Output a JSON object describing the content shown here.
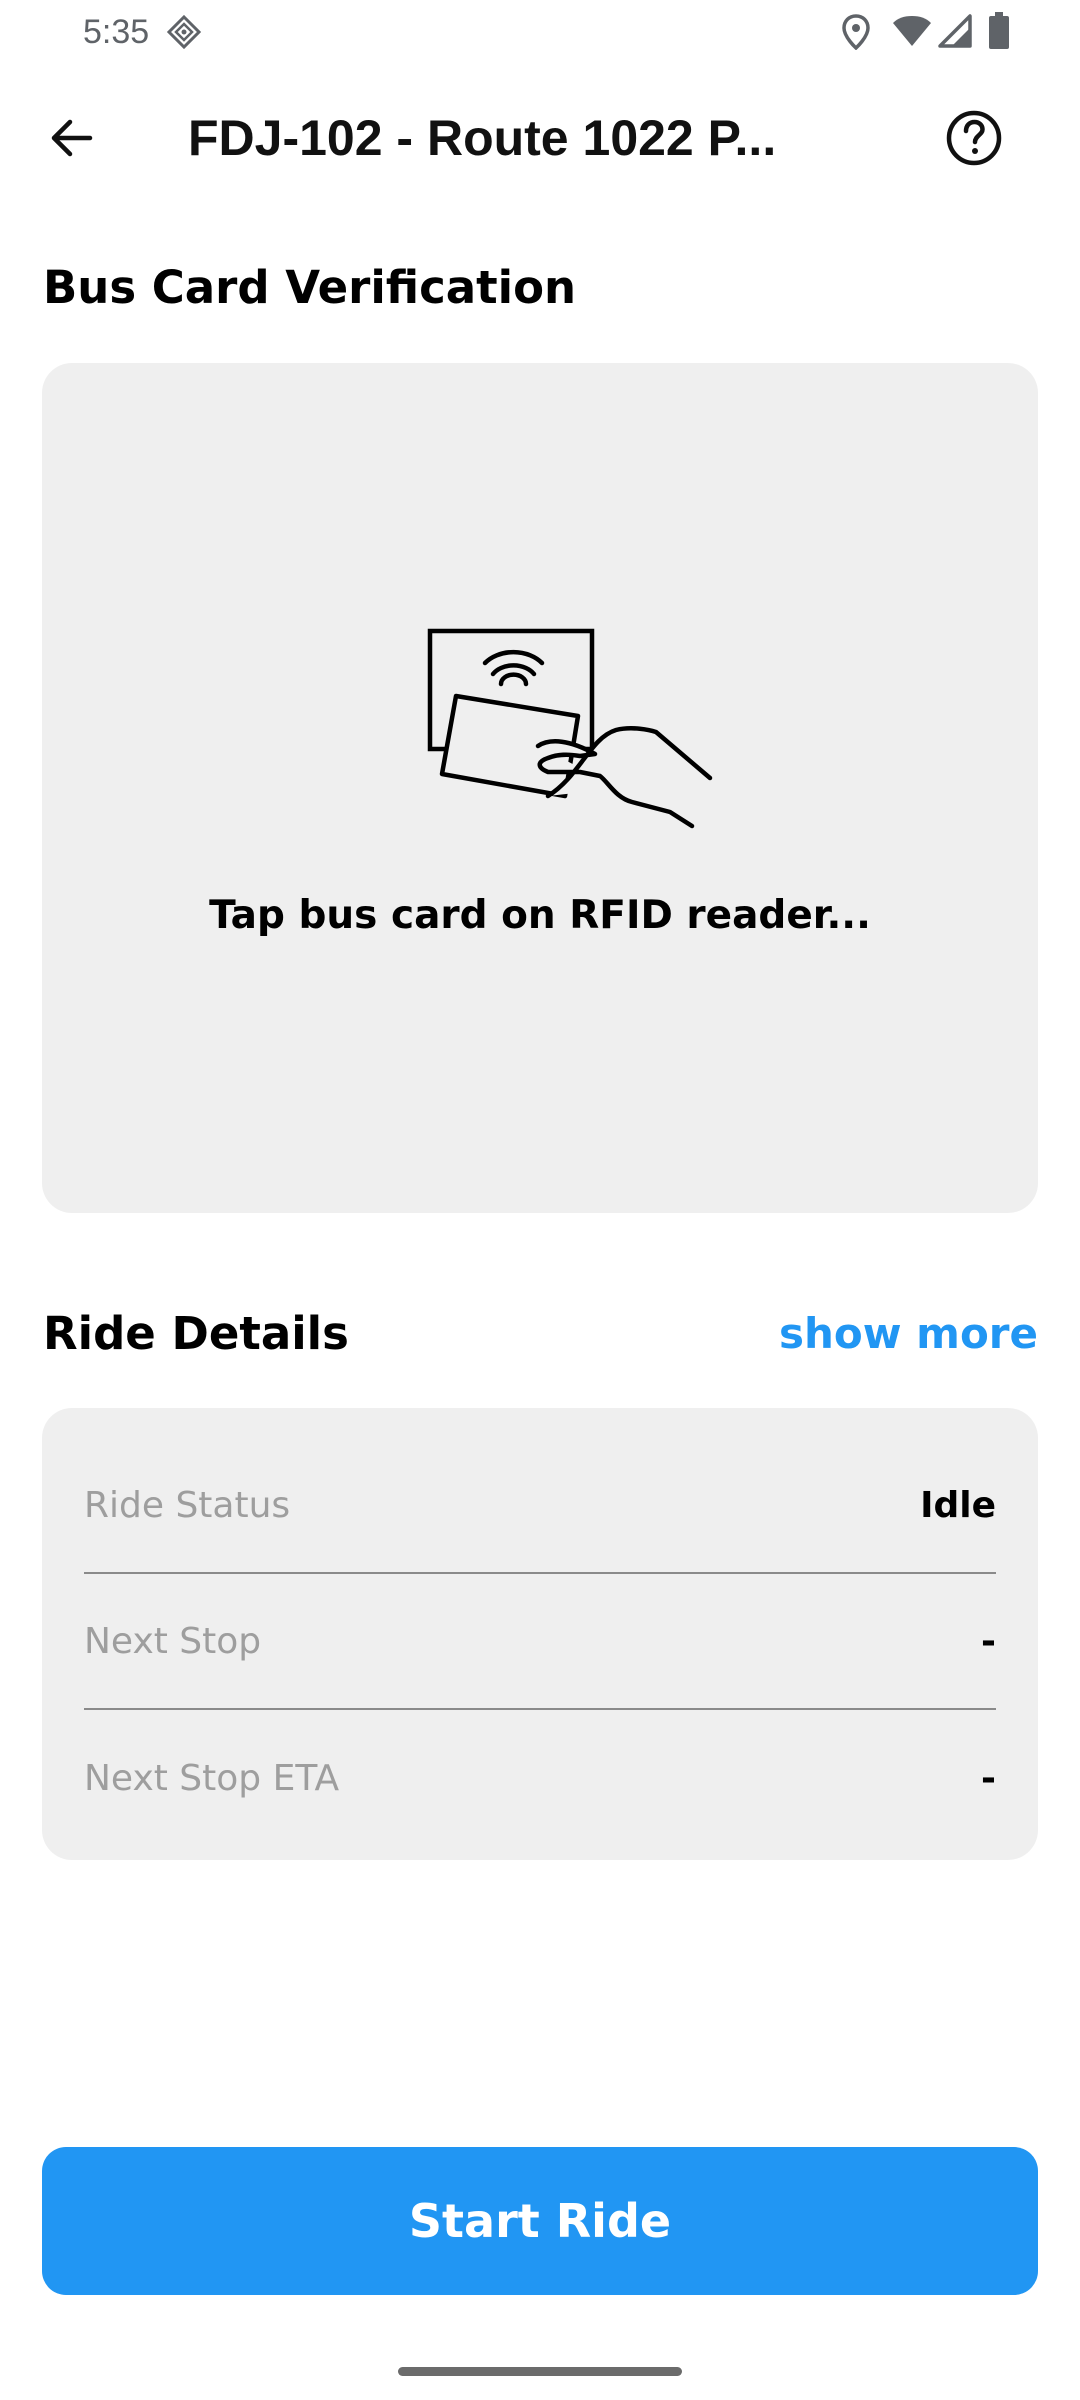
{
  "status_bar": {
    "time": "5:35",
    "icons": [
      "sim-settings-icon",
      "location-icon",
      "wifi-icon",
      "signal-icon",
      "battery-icon"
    ]
  },
  "app_bar": {
    "back_icon": "arrow-left-icon",
    "title": "FDJ-102 - Route 1022 P...",
    "help_icon": "help-circle-icon"
  },
  "verification": {
    "heading": "Bus Card Verification",
    "illustration_icon": "tap-card-rfid-icon",
    "prompt": "Tap bus card on RFID reader..."
  },
  "ride_details": {
    "heading": "Ride Details",
    "show_more_label": "show more",
    "rows": [
      {
        "label": "Ride Status",
        "value": "Idle"
      },
      {
        "label": "Next Stop",
        "value": "-"
      },
      {
        "label": "Next Stop ETA",
        "value": "-"
      }
    ]
  },
  "actions": {
    "start_ride_label": "Start Ride"
  },
  "colors": {
    "accent": "#2196f3",
    "card_background": "#efefef",
    "label_text": "#9e9e9e"
  }
}
